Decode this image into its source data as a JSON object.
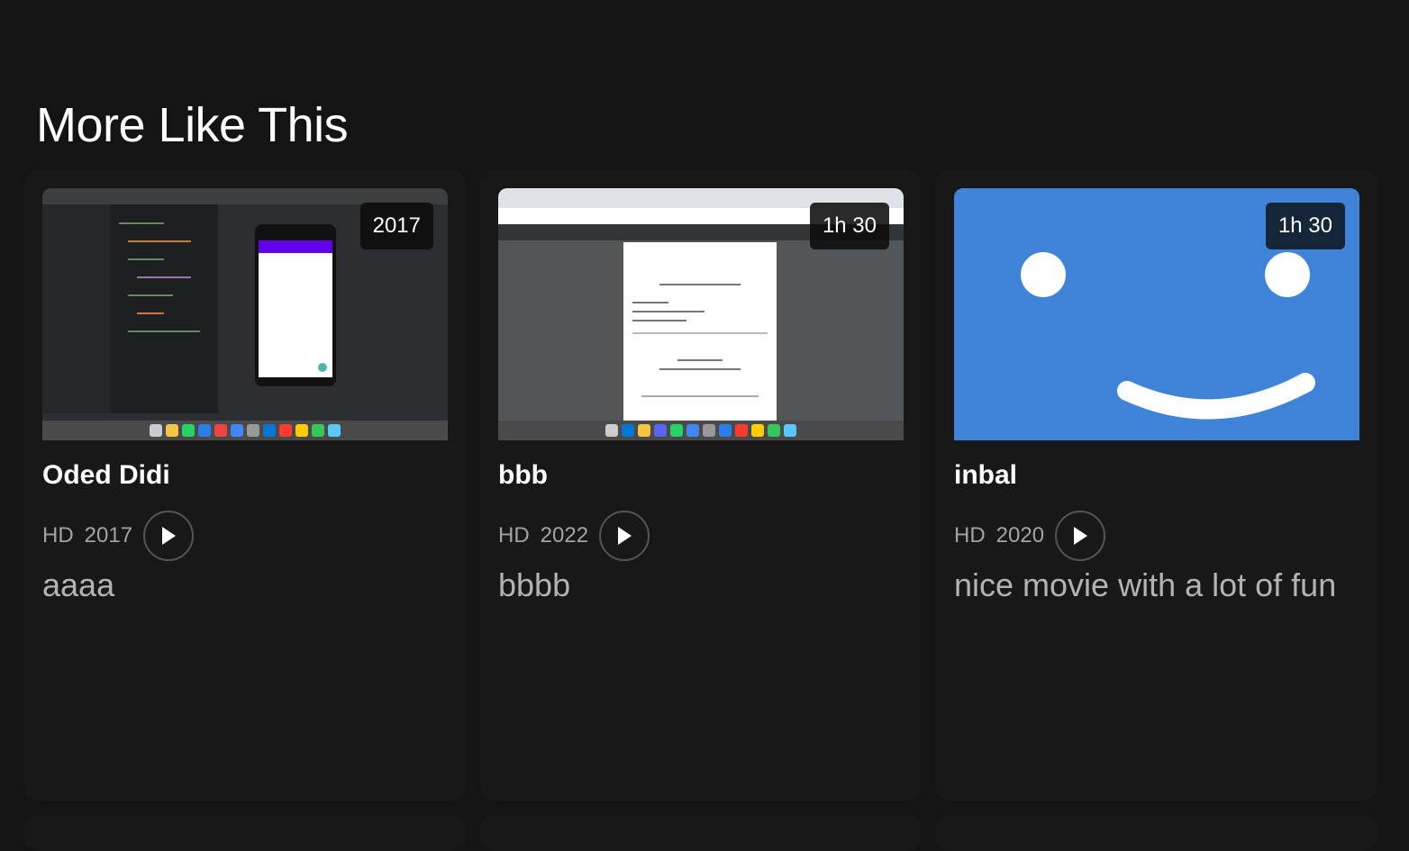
{
  "section": {
    "title": "More Like This"
  },
  "cards": [
    {
      "title": "Oded Didi",
      "quality": "HD",
      "year": "2017",
      "badge": "2017",
      "description": "aaaa",
      "thumbnail": "ide-screenshot"
    },
    {
      "title": "bbb",
      "quality": "HD",
      "year": "2022",
      "badge": "1h 30",
      "description": "bbbb",
      "thumbnail": "pdf-screenshot"
    },
    {
      "title": "inbal",
      "quality": "HD",
      "year": "2020",
      "badge": "1h 30",
      "description": "nice movie with a lot of fun",
      "thumbnail": "smiley-face"
    }
  ],
  "icons": {
    "play": "play-icon"
  },
  "colors": {
    "background": "#141414",
    "card": "#181818",
    "smiley_bg": "#3f83d9"
  }
}
